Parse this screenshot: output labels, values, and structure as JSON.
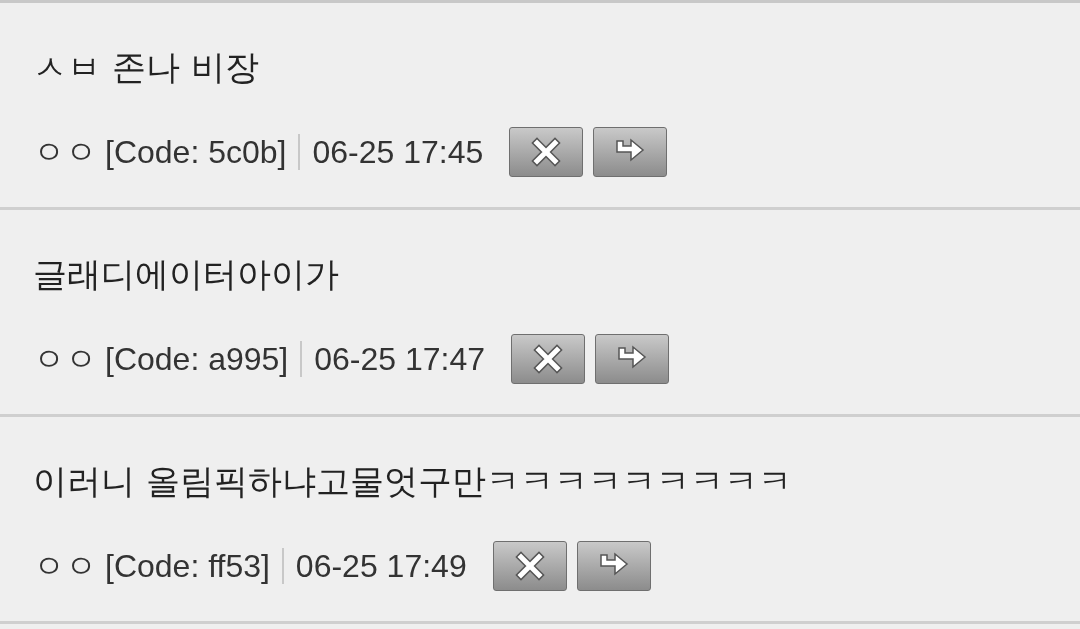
{
  "comments": [
    {
      "text": "ㅅㅂ 존나 비장",
      "author": "ㅇㅇ",
      "code": "[Code: 5c0b]",
      "time": "06-25 17:45"
    },
    {
      "text": "글래디에이터아이가",
      "author": "ㅇㅇ",
      "code": "[Code: a995]",
      "time": "06-25 17:47"
    },
    {
      "text": "이러니 올림픽하냐고물엇구만ㅋㅋㅋㅋㅋㅋㅋㅋㅋ",
      "author": "ㅇㅇ",
      "code": "[Code: ff53]",
      "time": "06-25 17:49"
    }
  ]
}
